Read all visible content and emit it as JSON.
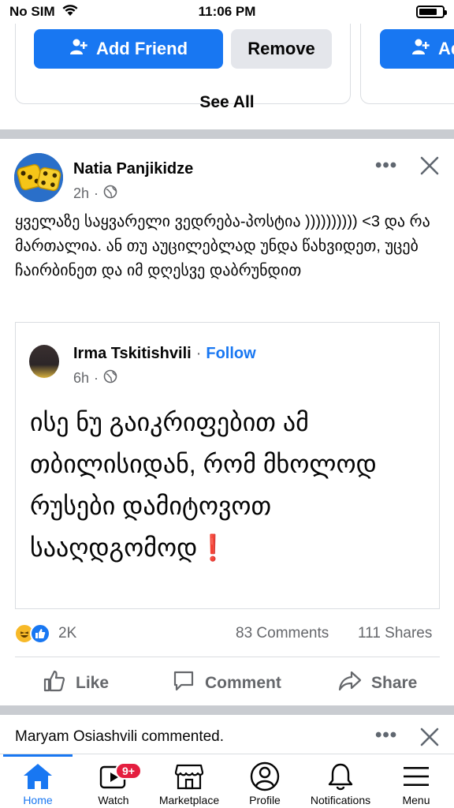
{
  "status_bar": {
    "carrier": "No SIM",
    "time": "11:06 PM"
  },
  "suggestions": {
    "add_friend_label": "Add Friend",
    "add_friend_partial_label": "Ad",
    "remove_label": "Remove",
    "see_all_label": "See All"
  },
  "post": {
    "author": "Natia Panjikidze",
    "time": "2h",
    "text": "ყველაზე საყვარელი ვედრება-პოსტია )))))))))) <3 და რა მართალია. ან თუ აუცილებლად უნდა წახვიდეთ, უცებ ჩაირბინეთ და იმ დღესვე დაბრუნდით",
    "shared": {
      "author": "Irma Tskitishvili",
      "separator": "·",
      "follow_label": "Follow",
      "time": "6h",
      "text": "ისე ნუ გაიკრიფებით ამ თბილისიდან, რომ მხოლოდ  რუსები დამიტოვოთ სააღდგომოდ",
      "emoji": "❗"
    },
    "reactions_count": "2K",
    "comments_count": "83 Comments",
    "shares_count": "111 Shares",
    "actions": {
      "like": "Like",
      "comment": "Comment",
      "share": "Share"
    }
  },
  "next_notification": {
    "text": "Maryam Osiashvili commented."
  },
  "tabbar": {
    "tabs": [
      {
        "label": "Home",
        "active": true
      },
      {
        "label": "Watch",
        "badge": "9+"
      },
      {
        "label": "Marketplace"
      },
      {
        "label": "Profile"
      },
      {
        "label": "Notifications"
      },
      {
        "label": "Menu"
      }
    ]
  },
  "colors": {
    "brand": "#1877f2",
    "badge": "#e41e3f",
    "divider": "#c9ccd1",
    "secondary_text": "#65676b"
  },
  "icons": [
    "wifi-icon",
    "battery-icon",
    "add-person-icon",
    "globe-icon",
    "more-icon",
    "close-icon",
    "haha-reaction-icon",
    "like-reaction-icon",
    "like-icon",
    "comment-icon",
    "share-icon",
    "home-icon",
    "watch-icon",
    "marketplace-icon",
    "profile-icon",
    "notifications-icon",
    "menu-icon"
  ]
}
